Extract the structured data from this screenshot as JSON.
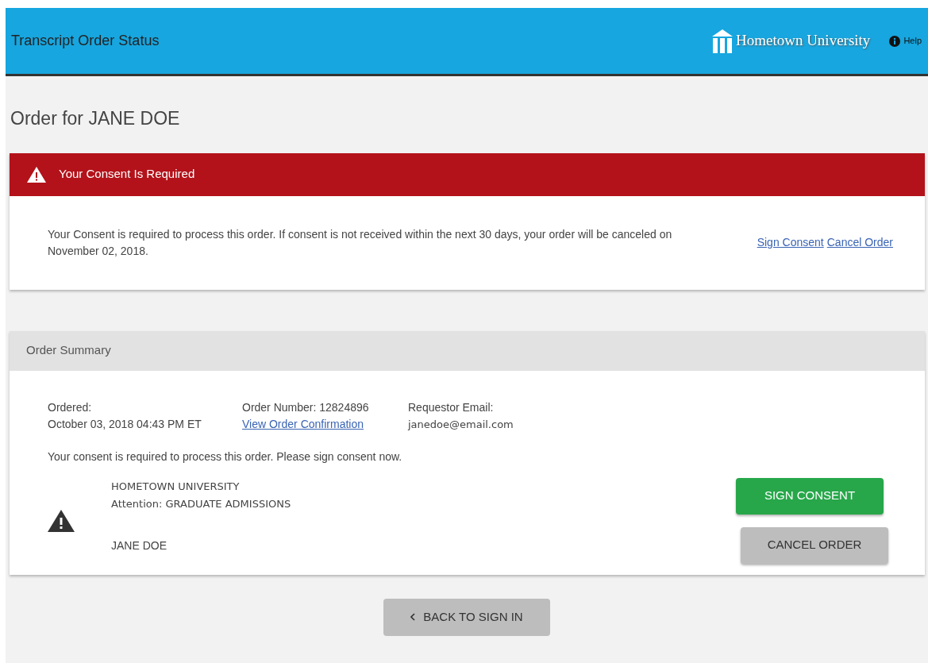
{
  "header": {
    "title": "Transcript Order Status",
    "logo_text": "Hometown University",
    "help": "Help"
  },
  "page_title": "Order for JANE DOE",
  "alert": {
    "title": "Your Consent Is Required",
    "message": "Your Consent is required to process this order. If consent is not received within the next 30 days, your order will be canceled on November 02, 2018.",
    "links": [
      "Sign Consent",
      "Cancel Order"
    ]
  },
  "summary": {
    "title": "Order Summary",
    "ordered_label": "Ordered:",
    "ordered_value": "October 03, 2018 04:43 PM ET",
    "order_number": "Order Number: 12824896",
    "confirmation_link": "View Order Confirmation",
    "email_label": "Requestor Email:",
    "email_value": "janedoe@email.com",
    "notice": "Your consent is required to process this order. Please sign consent now.",
    "recipient": [
      "HOMETOWN UNIVERSITY",
      "Attention: GRADUATE ADMISSIONS"
    ],
    "name": "JANE DOE",
    "buttons": [
      {
        "label": "SIGN CONSENT",
        "kind": "primary"
      },
      {
        "label": "CANCEL ORDER",
        "kind": "secondary"
      }
    ]
  },
  "back_button": "BACK TO SIGN IN"
}
